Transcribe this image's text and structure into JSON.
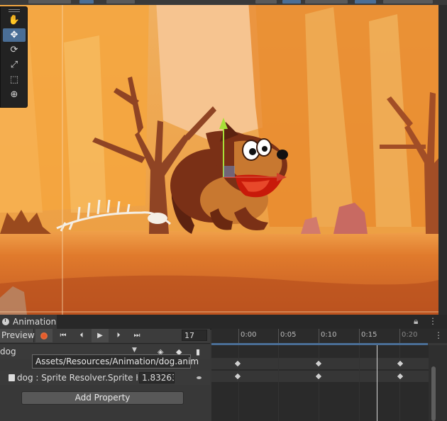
{
  "scene": {
    "tools": [
      {
        "icon": "hand-icon",
        "glyph": "✋"
      },
      {
        "icon": "move-icon",
        "glyph": "✥"
      },
      {
        "icon": "rotate-icon",
        "glyph": "⟳"
      },
      {
        "icon": "scale-icon",
        "glyph": "⤢"
      },
      {
        "icon": "rect-tool-icon",
        "glyph": "⬚"
      },
      {
        "icon": "transform-icon",
        "glyph": "⊕"
      }
    ],
    "active_tool": "move-icon",
    "colors": {
      "sky": "#f3c38e",
      "ground": "#e07a2c",
      "trees": "#9a4a26",
      "dog_dark": "#6a2a14",
      "dog_light": "#c9772e",
      "tongue": "#d42a12"
    }
  },
  "animation": {
    "tab_title": "Animation",
    "preview_label": "Preview",
    "transport_icons": [
      "record-icon",
      "first-key-icon",
      "prev-key-icon",
      "play-icon",
      "next-key-icon",
      "last-key-icon"
    ],
    "frame": "17",
    "timeline_labels": [
      "0:00",
      "0:05",
      "0:10",
      "0:15",
      "0:20"
    ],
    "clip_name": "dog",
    "tooltip": "Assets/Resources/Animation/dog.anim",
    "property": {
      "name": "dog : Sprite Resolver.Sprite Key",
      "value": "1.83263"
    },
    "add_property_label": "Add Property",
    "accent_color": "#4a6e96",
    "record_color": "#e85a2a"
  }
}
